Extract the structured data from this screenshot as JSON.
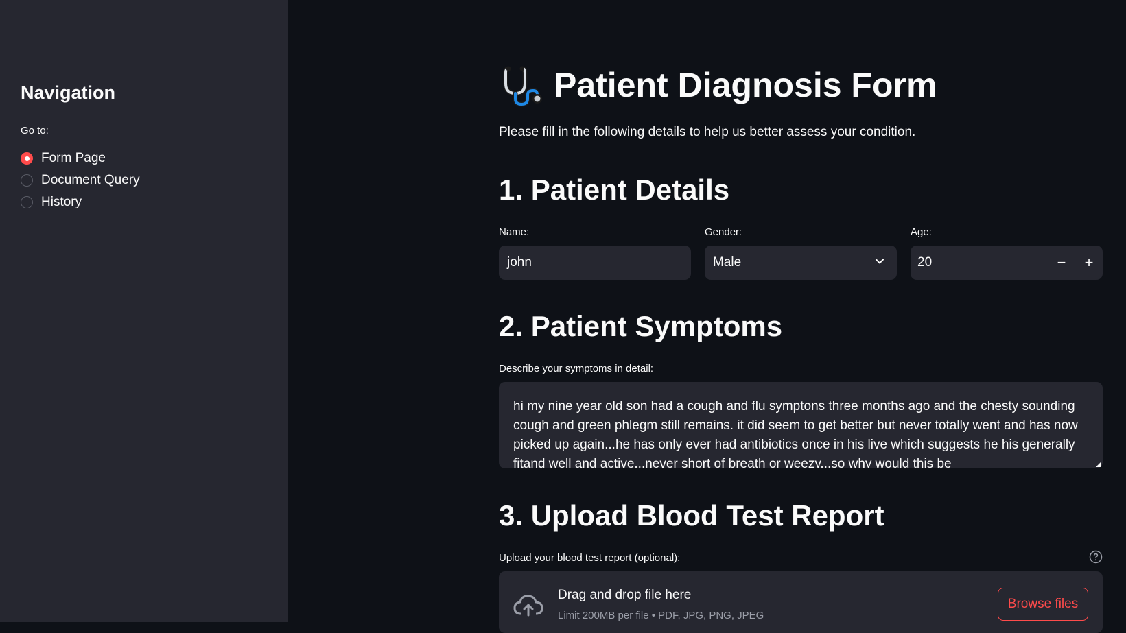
{
  "sidebar": {
    "title": "Navigation",
    "goto_label": "Go to:",
    "options": [
      {
        "label": "Form Page",
        "selected": true
      },
      {
        "label": "Document Query",
        "selected": false
      },
      {
        "label": "History",
        "selected": false
      }
    ]
  },
  "header": {
    "icon": "stethoscope-icon",
    "title": "Patient Diagnosis Form",
    "subtitle": "Please fill in the following details to help us better assess your condition."
  },
  "section1": {
    "heading": "1. Patient Details",
    "name_label": "Name:",
    "name_value": "john",
    "gender_label": "Gender:",
    "gender_value": "Male",
    "age_label": "Age:",
    "age_value": "20",
    "minus": "−",
    "plus": "+"
  },
  "section2": {
    "heading": "2. Patient Symptoms",
    "label": "Describe your symptoms in detail:",
    "value": "hi my nine year old son had a cough and flu symptons three months ago and the chesty sounding cough and green phlegm still remains. it did seem to get better but never totally went and has now picked up again...he has only ever had antibiotics once in his live which suggests he his generally fitand well and active...never short of breath or weezy...so why would this be"
  },
  "section3": {
    "heading": "3. Upload Blood Test Report",
    "label": "Upload your blood test report (optional):",
    "drag_text": "Drag and drop file here",
    "limit_text": "Limit 200MB per file • PDF, JPG, PNG, JPEG",
    "browse_label": "Browse files"
  },
  "colors": {
    "accent": "#ff4b4b",
    "background": "#0e1117",
    "sidebar": "#262730"
  }
}
